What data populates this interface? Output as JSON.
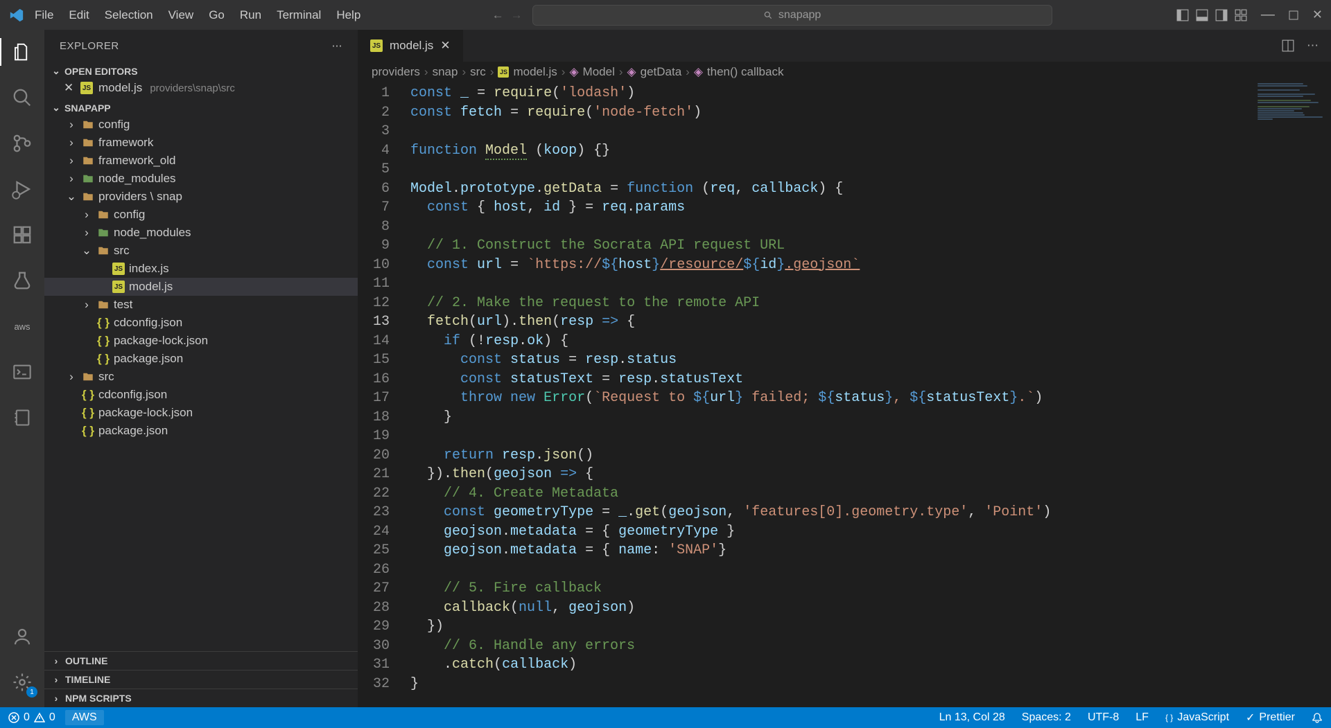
{
  "menu": [
    "File",
    "Edit",
    "Selection",
    "View",
    "Go",
    "Run",
    "Terminal",
    "Help"
  ],
  "search_placeholder": "snapapp",
  "explorer": {
    "title": "EXPLORER",
    "open_editors": "OPEN EDITORS",
    "open_file": {
      "name": "model.js",
      "path": "providers\\snap\\src"
    },
    "workspace": "SNAPAPP",
    "tree": [
      {
        "indent": 1,
        "type": "folder",
        "name": "config",
        "expanded": false
      },
      {
        "indent": 1,
        "type": "folder",
        "name": "framework",
        "expanded": false
      },
      {
        "indent": 1,
        "type": "folder",
        "name": "framework_old",
        "expanded": false
      },
      {
        "indent": 1,
        "type": "folder",
        "name": "node_modules",
        "expanded": false,
        "green": true
      },
      {
        "indent": 1,
        "type": "folder",
        "name": "providers \\ snap",
        "expanded": true
      },
      {
        "indent": 2,
        "type": "folder",
        "name": "config",
        "expanded": false
      },
      {
        "indent": 2,
        "type": "folder",
        "name": "node_modules",
        "expanded": false,
        "green": true
      },
      {
        "indent": 2,
        "type": "folder",
        "name": "src",
        "expanded": true
      },
      {
        "indent": 3,
        "type": "js",
        "name": "index.js"
      },
      {
        "indent": 3,
        "type": "js",
        "name": "model.js",
        "selected": true
      },
      {
        "indent": 2,
        "type": "folder",
        "name": "test",
        "expanded": false
      },
      {
        "indent": 2,
        "type": "json",
        "name": "cdconfig.json"
      },
      {
        "indent": 2,
        "type": "json",
        "name": "package-lock.json"
      },
      {
        "indent": 2,
        "type": "json",
        "name": "package.json"
      },
      {
        "indent": 1,
        "type": "folder",
        "name": "src",
        "expanded": false
      },
      {
        "indent": 1,
        "type": "json",
        "name": "cdconfig.json"
      },
      {
        "indent": 1,
        "type": "json",
        "name": "package-lock.json"
      },
      {
        "indent": 1,
        "type": "json",
        "name": "package.json"
      }
    ],
    "panels": [
      "OUTLINE",
      "TIMELINE",
      "NPM SCRIPTS"
    ]
  },
  "tab": {
    "file": "model.js"
  },
  "breadcrumb": [
    "providers",
    "snap",
    "src",
    "model.js",
    "Model",
    "getData",
    "then() callback"
  ],
  "code_lines": [
    1,
    2,
    3,
    4,
    5,
    6,
    7,
    8,
    9,
    10,
    11,
    12,
    13,
    14,
    15,
    16,
    17,
    18,
    19,
    20,
    21,
    22,
    23,
    24,
    25,
    26,
    27,
    28,
    29,
    30,
    31,
    32
  ],
  "active_line": 13,
  "statusbar": {
    "errors": "0",
    "warnings": "0",
    "aws": "AWS",
    "cursor": "Ln 13, Col 28",
    "spaces": "Spaces: 2",
    "encoding": "UTF-8",
    "eol": "LF",
    "language": "JavaScript",
    "prettier": "Prettier"
  },
  "code": {
    "l1": {
      "a": "const",
      "b": "_",
      "c": "require",
      "d": "'lodash'"
    },
    "l2": {
      "a": "const",
      "b": "fetch",
      "c": "require",
      "d": "'node-fetch'"
    },
    "l4": {
      "a": "function",
      "b": "Model",
      "c": "koop"
    },
    "l6": {
      "a": "Model",
      "b": "prototype",
      "c": "getData",
      "d": "function",
      "e": "req",
      "f": "callback"
    },
    "l7": {
      "a": "const",
      "b": "host",
      "c": "id",
      "d": "req",
      "e": "params"
    },
    "l9": "// 1. Construct the Socrata API request URL",
    "l10": {
      "a": "const",
      "b": "url",
      "c": "`https://",
      "d": "host",
      "e": "/resource/",
      "f": "id",
      "g": ".geojson`"
    },
    "l12": "// 2. Make the request to the remote API",
    "l13": {
      "a": "fetch",
      "b": "url",
      "c": "then",
      "d": "resp"
    },
    "l14": {
      "a": "if",
      "b": "resp",
      "c": "ok"
    },
    "l15": {
      "a": "const",
      "b": "status",
      "c": "resp",
      "d": "status"
    },
    "l16": {
      "a": "const",
      "b": "statusText",
      "c": "resp",
      "d": "statusText"
    },
    "l17": {
      "a": "throw",
      "b": "new",
      "c": "Error",
      "d": "`Request to ",
      "e": "url",
      "f": " failed; ",
      "g": "status",
      "h": ", ",
      "i": "statusText",
      "j": ".`"
    },
    "l20": {
      "a": "return",
      "b": "resp",
      "c": "json"
    },
    "l21": {
      "a": "then",
      "b": "geojson"
    },
    "l22": "// 4. Create Metadata",
    "l23": {
      "a": "const",
      "b": "geometryType",
      "c": "_",
      "d": "get",
      "e": "geojson",
      "f": "'features[0].geometry.type'",
      "g": "'Point'"
    },
    "l24": {
      "a": "geojson",
      "b": "metadata",
      "c": "geometryType"
    },
    "l25": {
      "a": "geojson",
      "b": "metadata",
      "c": "name",
      "d": "'SNAP'"
    },
    "l27": "// 5. Fire callback",
    "l28": {
      "a": "callback",
      "b": "null",
      "c": "geojson"
    },
    "l30": "// 6. Handle any errors",
    "l31": {
      "a": "catch",
      "b": "callback"
    }
  }
}
